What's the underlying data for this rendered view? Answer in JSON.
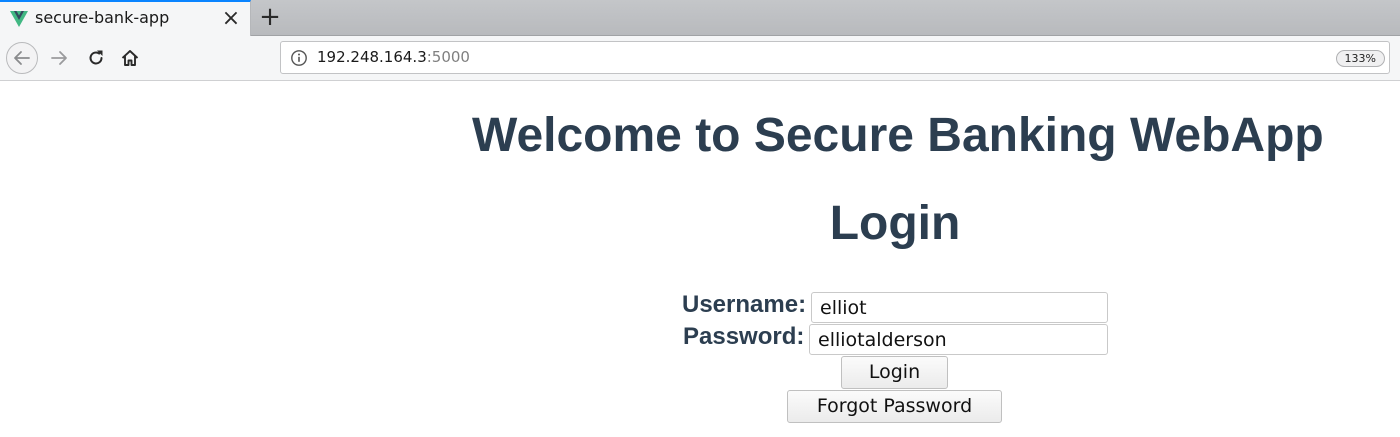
{
  "browser": {
    "tab": {
      "title": "secure-bank-app",
      "close_icon": "close-icon",
      "favicon": "vue-logo-icon"
    },
    "new_tab_label": "+",
    "address": {
      "host": "192.248.164.3",
      "port": ":5000"
    },
    "zoom": "133%"
  },
  "page": {
    "heading": "Welcome to Secure Banking WebApp",
    "login_title": "Login",
    "username_label": "Username:",
    "username_value": "elliot",
    "password_label": "Password:",
    "password_value": "elliotalderson",
    "login_button": "Login",
    "forgot_button": "Forgot Password"
  },
  "colors": {
    "heading": "#2c3e50",
    "tab_accent": "#0a84ff",
    "vue_green": "#41b883",
    "vue_dark": "#35495e"
  }
}
